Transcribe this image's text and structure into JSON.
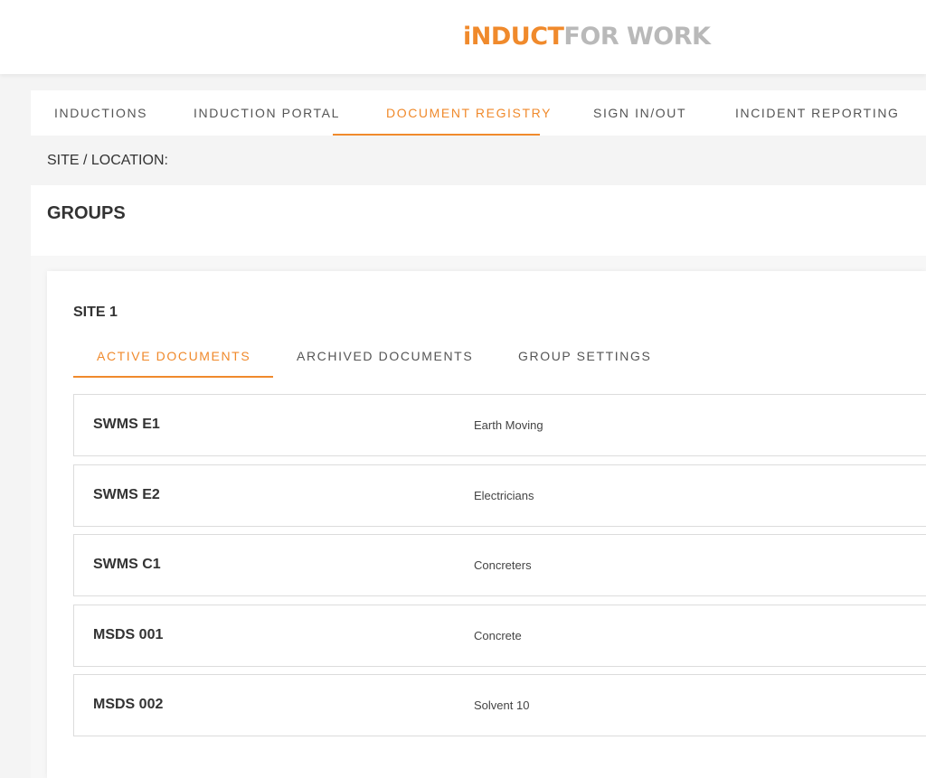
{
  "brand": {
    "logo_part1": "iNDUCT",
    "logo_part2": "FOR WORK",
    "accent_color": "#f08a2c"
  },
  "nav": {
    "tabs": [
      {
        "label": "INDUCTIONS",
        "active": false
      },
      {
        "label": "INDUCTION PORTAL",
        "active": false
      },
      {
        "label": "DOCUMENT REGISTRY",
        "active": true
      },
      {
        "label": "SIGN IN/OUT",
        "active": false
      },
      {
        "label": "INCIDENT REPORTING",
        "active": false
      }
    ]
  },
  "site_location": {
    "label": "SITE / LOCATION:"
  },
  "page": {
    "title": "GROUPS"
  },
  "group": {
    "name": "SITE 1",
    "tabs": [
      {
        "label": "ACTIVE DOCUMENTS",
        "active": true
      },
      {
        "label": "ARCHIVED DOCUMENTS",
        "active": false
      },
      {
        "label": "GROUP SETTINGS",
        "active": false
      }
    ],
    "documents": [
      {
        "code": "SWMS E1",
        "description": "Earth Moving"
      },
      {
        "code": "SWMS E2",
        "description": "Electricians"
      },
      {
        "code": "SWMS C1",
        "description": "Concreters"
      },
      {
        "code": "MSDS 001",
        "description": "Concrete"
      },
      {
        "code": "MSDS 002",
        "description": "Solvent 10"
      }
    ]
  }
}
